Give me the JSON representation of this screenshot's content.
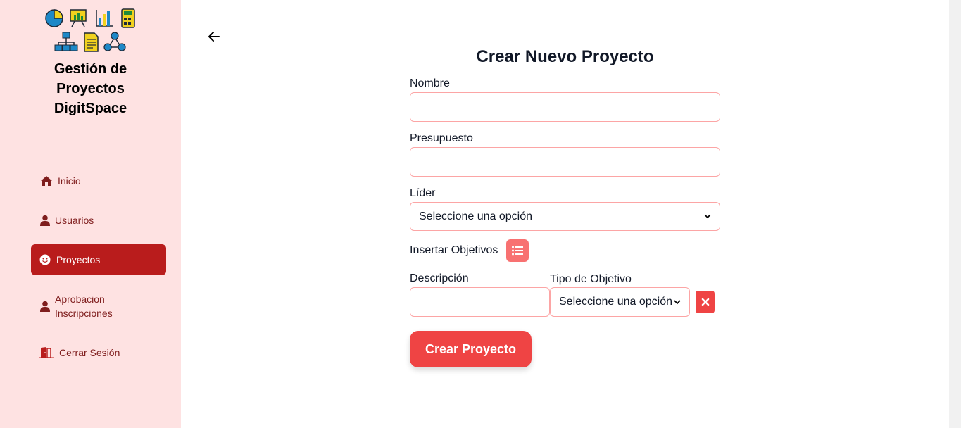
{
  "sidebar": {
    "brand_line1": "Gestión de",
    "brand_line2": "Proyectos",
    "brand_line3": "DigitSpace",
    "items": [
      {
        "label": "Inicio",
        "icon": "home-icon"
      },
      {
        "label": "Usuarios",
        "icon": "user-icon"
      },
      {
        "label": "Proyectos",
        "icon": "smile-icon",
        "active": true
      },
      {
        "label_line1": "Aprobacion",
        "label_line2": "Inscripciones",
        "icon": "user-icon"
      },
      {
        "label": "Cerrar Sesión",
        "icon": "door-icon"
      }
    ]
  },
  "form": {
    "title": "Crear Nuevo Proyecto",
    "nombre_label": "Nombre",
    "nombre_value": "",
    "presupuesto_label": "Presupuesto",
    "presupuesto_value": "",
    "lider_label": "Líder",
    "lider_selected": "Seleccione una opción",
    "objetivos_label": "Insertar Objetivos",
    "descripcion_label": "Descripción",
    "descripcion_value": "",
    "tipo_label": "Tipo de Objetivo",
    "tipo_selected": "Seleccione una opción",
    "submit_label": "Crear Proyecto"
  },
  "colors": {
    "sidebar_bg": "#fee2e2",
    "active_item": "#b91c1c",
    "accent": "#ef4444",
    "input_border": "#fca5a5"
  }
}
